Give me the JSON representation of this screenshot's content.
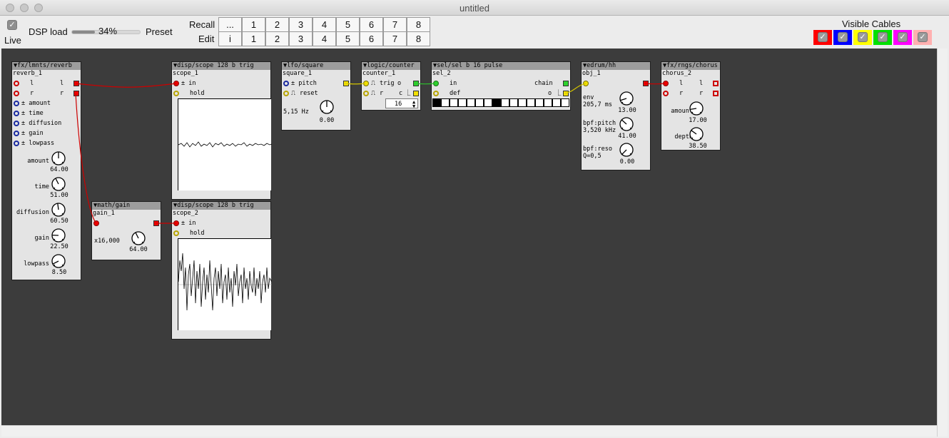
{
  "window": {
    "title": "untitled"
  },
  "toolbar": {
    "live_label": "Live",
    "dsp_label": "DSP load",
    "dsp_value": "34%",
    "dsp_fraction": 0.34,
    "preset_label": "Preset",
    "recall_label": "Recall",
    "edit_label": "Edit",
    "recall_buttons": [
      "...",
      "1",
      "2",
      "3",
      "4",
      "5",
      "6",
      "7",
      "8"
    ],
    "edit_buttons": [
      "i",
      "1",
      "2",
      "3",
      "4",
      "5",
      "6",
      "7",
      "8"
    ],
    "visible_cables_label": "Visible Cables",
    "cable_colors": [
      "#ff0000",
      "#0000ff",
      "#ffff00",
      "#00e000",
      "#ff00ff",
      "#ffb0b0"
    ]
  },
  "objects": {
    "reverb": {
      "type": "▼fx/lmnts/reverb",
      "name": "reverb_1",
      "in_l": "l",
      "in_r": "r",
      "out_l": "l",
      "out_r": "r",
      "params": [
        "± amount",
        "± time",
        "± diffusion",
        "± gain",
        "± lowpass"
      ],
      "knobs": [
        {
          "label": "amount",
          "value": "64.00"
        },
        {
          "label": "time",
          "value": "51.00"
        },
        {
          "label": "diffusion",
          "value": "60.50"
        },
        {
          "label": "gain",
          "value": "22.50"
        },
        {
          "label": "lowpass",
          "value": "8.50"
        }
      ]
    },
    "gain": {
      "type": "▼math/gain",
      "name": "gain_1",
      "mult": "x16,000",
      "value": "64.00"
    },
    "scope1": {
      "type": "▼disp/scope 128 b trig",
      "name": "scope_1",
      "in": "± in",
      "hold": "hold"
    },
    "scope2": {
      "type": "▼disp/scope 128 b trig",
      "name": "scope_2",
      "in": "± in",
      "hold": "hold"
    },
    "square": {
      "type": "▼lfo/square",
      "name": "square_1",
      "pitch": "± pitch",
      "reset": "reset",
      "freq": "5,15 Hz",
      "value": "0.00"
    },
    "counter": {
      "type": "▼logic/counter",
      "name": "counter_1",
      "trig": "trig",
      "r": "r",
      "o": "o",
      "c": "c",
      "value": "16"
    },
    "sel": {
      "type": "▼sel/sel b 16 pulse",
      "name": "sel_2",
      "in": "in",
      "def": "def",
      "chain": "chain",
      "o": "o",
      "steps": [
        1,
        0,
        0,
        0,
        0,
        0,
        0,
        1,
        0,
        0,
        0,
        0,
        0,
        0,
        0,
        0
      ]
    },
    "hh": {
      "type": "▼edrum/hh",
      "name": "obj_1",
      "knobs": [
        {
          "label": "env",
          "sub": "205,7 ms",
          "value": "13.00"
        },
        {
          "label": "bpf:pitch",
          "sub": "3,520 kHz",
          "value": "41.00"
        },
        {
          "label": "bpf:reso",
          "sub": "Q=0,5",
          "value": "0.00"
        }
      ]
    },
    "chorus": {
      "type": "▼fx/rngs/chorus",
      "name": "chorus_2",
      "in_l": "l",
      "in_r": "r",
      "out_l": "l",
      "out_r": "r",
      "knobs": [
        {
          "label": "amount",
          "value": "17.00"
        },
        {
          "label": "depth",
          "value": "38.50"
        }
      ]
    }
  }
}
